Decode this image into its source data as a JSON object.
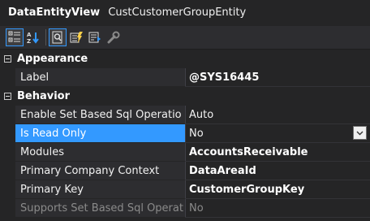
{
  "header": {
    "type_label": "DataEntityView",
    "object_name": "CustCustomerGroupEntity"
  },
  "toolbar": {
    "buttons": [
      {
        "icon": "categorized-icon",
        "active": true
      },
      {
        "icon": "alphabetical-sort-icon",
        "active": false
      },
      {
        "icon": "properties-icon",
        "active": true
      },
      {
        "icon": "events-icon",
        "active": false
      },
      {
        "icon": "property-pages-icon",
        "active": false
      },
      {
        "icon": "wrench-icon",
        "active": false
      }
    ]
  },
  "categories": [
    {
      "label": "Appearance",
      "properties": [
        {
          "name": "Label",
          "value": "@SYS16445",
          "bold": true
        }
      ]
    },
    {
      "label": "Behavior",
      "properties": [
        {
          "name": "Enable Set Based Sql Operatio",
          "value": "Auto",
          "bold": false
        },
        {
          "name": "Is Read Only",
          "value": "No",
          "bold": false,
          "selected": true
        },
        {
          "name": "Modules",
          "value": "AccountsReceivable",
          "bold": true
        },
        {
          "name": "Primary Company Context",
          "value": "DataAreaId",
          "bold": true
        },
        {
          "name": "Primary Key",
          "value": "CustomerGroupKey",
          "bold": true
        },
        {
          "name": "Supports Set Based Sql Operat",
          "value": "No",
          "bold": false,
          "disabled": true
        }
      ]
    }
  ],
  "colors": {
    "background": "#252526",
    "selection": "#3399ff",
    "text": "#f1f1f1"
  }
}
